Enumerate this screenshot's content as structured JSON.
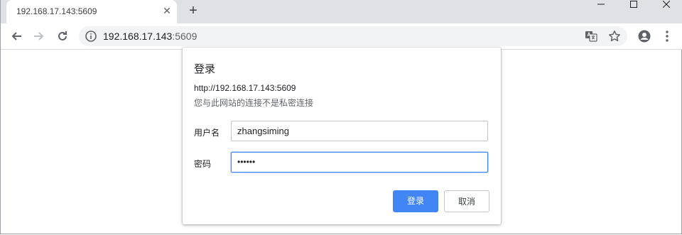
{
  "browser": {
    "tab_title": "192.168.17.143:5609",
    "tab_close": "✕",
    "new_tab": "+",
    "url_host": "192.168.17.143",
    "url_port": ":5609"
  },
  "dialog": {
    "title": "登录",
    "origin": "http://192.168.17.143:5609",
    "warning": "您与此网站的连接不是私密连接",
    "username_label": "用户名",
    "username_value": "zhangsiming",
    "password_label": "密码",
    "password_value": "••••••",
    "login_button": "登录",
    "cancel_button": "取消"
  },
  "colors": {
    "accent": "#4285f4",
    "tabstrip": "#dee1e6",
    "omnibox": "#f1f3f4"
  }
}
